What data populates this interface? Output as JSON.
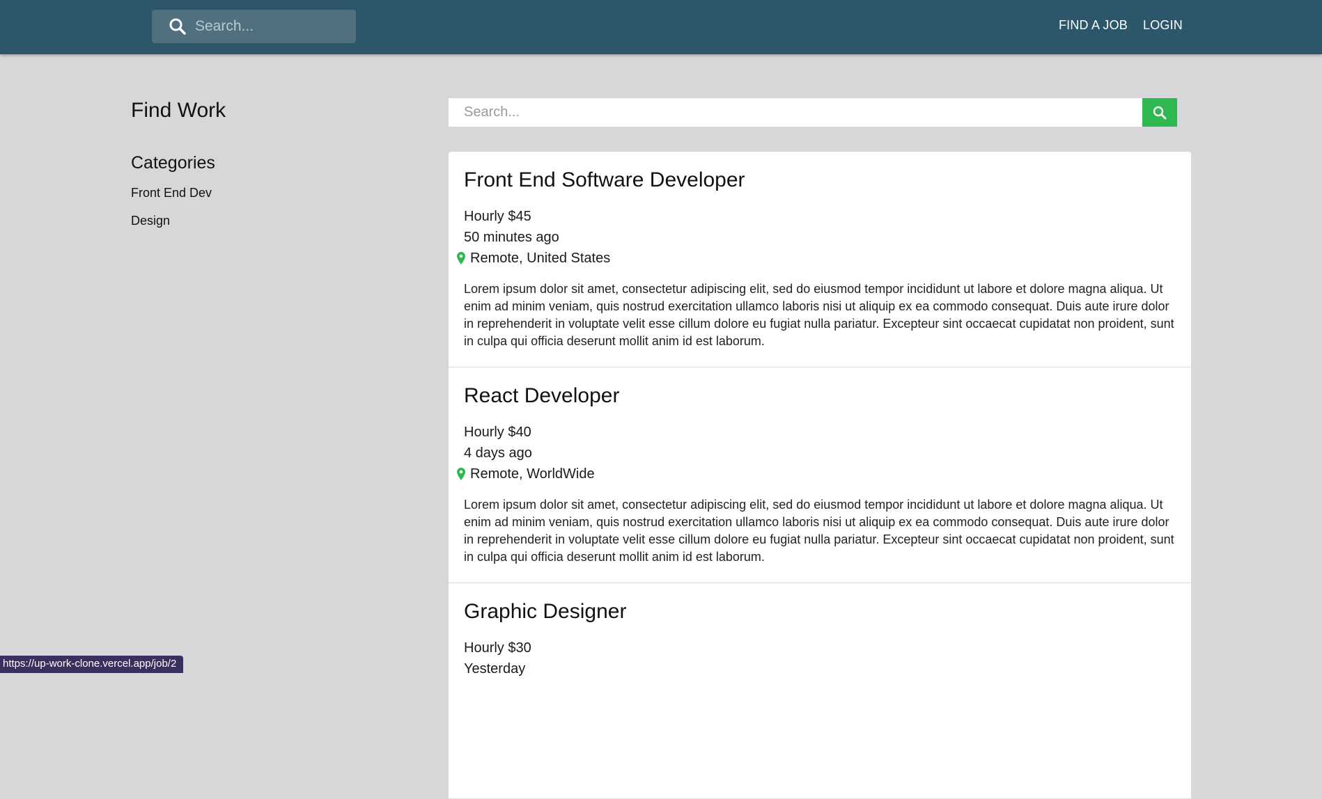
{
  "header": {
    "search_placeholder": "Search...",
    "nav": {
      "find_job": "FIND A JOB",
      "login": "LOGIN"
    }
  },
  "sidebar": {
    "title": "Find Work",
    "categories_heading": "Categories",
    "categories": [
      "Front End Dev",
      "Design"
    ]
  },
  "main": {
    "search_placeholder": "Search...",
    "jobs": [
      {
        "title": "Front End Software Developer",
        "rate": "Hourly $45",
        "posted": "50 minutes ago",
        "location": "Remote, United States",
        "description": "Lorem ipsum dolor sit amet, consectetur adipiscing elit, sed do eiusmod tempor incididunt ut labore et dolore magna aliqua. Ut enim ad minim veniam, quis nostrud exercitation ullamco laboris nisi ut aliquip ex ea commodo consequat. Duis aute irure dolor in reprehenderit in voluptate velit esse cillum dolore eu fugiat nulla pariatur. Excepteur sint occaecat cupidatat non proident, sunt in culpa qui officia deserunt mollit anim id est laborum."
      },
      {
        "title": "React Developer",
        "rate": "Hourly $40",
        "posted": "4 days ago",
        "location": "Remote, WorldWide",
        "description": "Lorem ipsum dolor sit amet, consectetur adipiscing elit, sed do eiusmod tempor incididunt ut labore et dolore magna aliqua. Ut enim ad minim veniam, quis nostrud exercitation ullamco laboris nisi ut aliquip ex ea commodo consequat. Duis aute irure dolor in reprehenderit in voluptate velit esse cillum dolore eu fugiat nulla pariatur. Excepteur sint occaecat cupidatat non proident, sunt in culpa qui officia deserunt mollit anim id est laborum."
      },
      {
        "title": "Graphic Designer",
        "rate": "Hourly $30",
        "posted": "Yesterday",
        "location": "",
        "description": ""
      }
    ]
  },
  "status_bar": {
    "url": "https://up-work-clone.vercel.app/job/2"
  },
  "colors": {
    "header_bg": "#2c576b",
    "accent_green": "#2fb84f",
    "page_bg": "#d7d7d9"
  }
}
